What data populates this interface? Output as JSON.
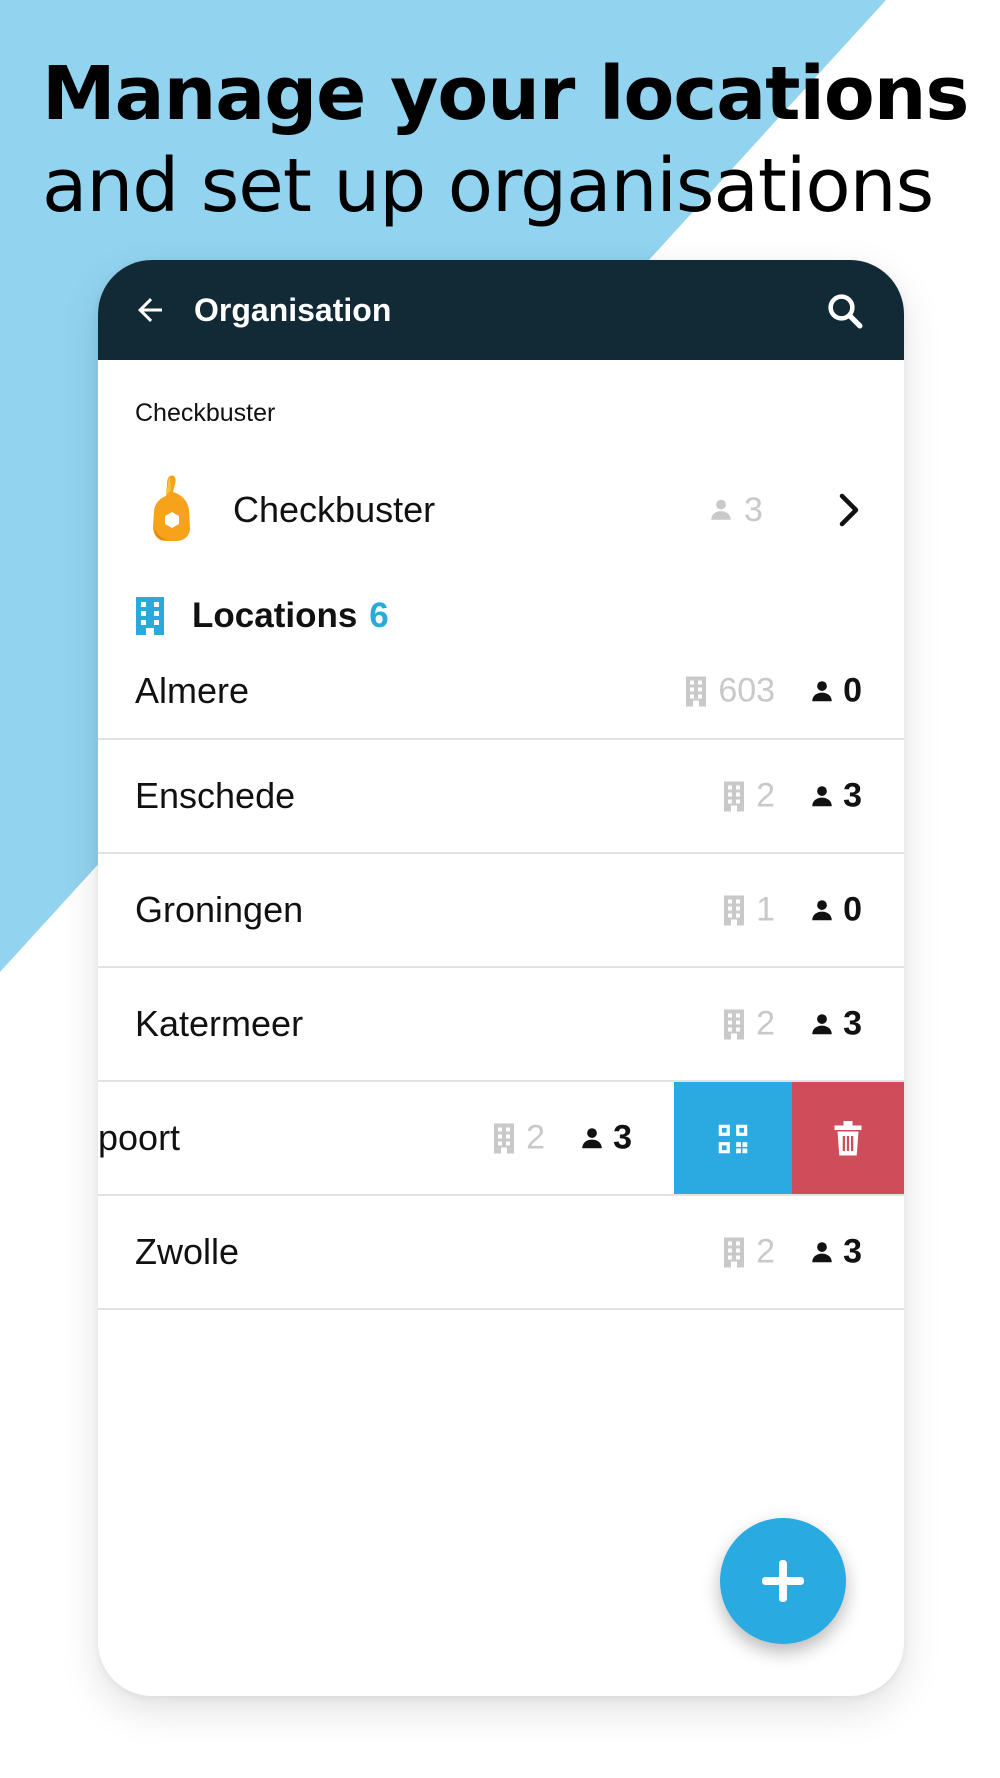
{
  "headline": {
    "line1": "Manage your locations",
    "line2": "and set up organisations"
  },
  "colors": {
    "accent_blue": "#2aa9dd",
    "background_triangle": "#92d4f0",
    "appbar": "#112a36",
    "delete_red": "#cf4c5a",
    "muted_gray": "#c9c9c9"
  },
  "appbar": {
    "back_icon": "arrow-left-icon",
    "title": "Organisation",
    "search_icon": "search-icon"
  },
  "organisation_section": {
    "label": "Checkbuster",
    "item": {
      "name": "Checkbuster",
      "users": "3",
      "logo_icon": "ok-hand-icon",
      "chevron_icon": "chevron-right-icon"
    }
  },
  "locations": {
    "label": "Locations",
    "count": "6",
    "items": [
      {
        "name": "Almere",
        "buildings": "603",
        "people": "0"
      },
      {
        "name": "Enschede",
        "buildings": "2",
        "people": "3"
      },
      {
        "name": "Groningen",
        "buildings": "1",
        "people": "0"
      },
      {
        "name": "Katermeer",
        "buildings": "2",
        "people": "3"
      },
      {
        "name": "poort",
        "buildings": "2",
        "people": "3"
      },
      {
        "name": "Zwolle",
        "buildings": "2",
        "people": "3"
      }
    ]
  },
  "swipe_actions": {
    "qr_icon": "qr-code-icon",
    "delete_icon": "trash-icon"
  },
  "fab": {
    "icon": "plus-icon"
  }
}
